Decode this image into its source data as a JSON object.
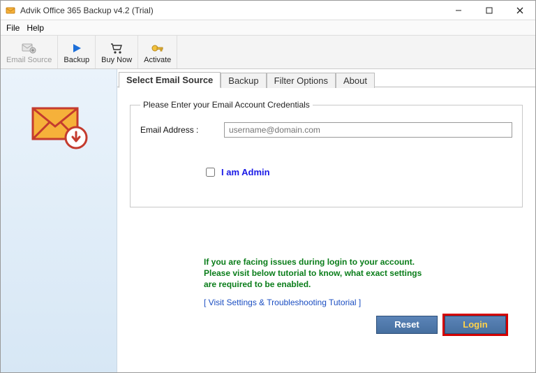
{
  "titlebar": {
    "title": "Advik Office 365 Backup v4.2 (Trial)"
  },
  "menu": {
    "file": "File",
    "help": "Help"
  },
  "toolbar": {
    "email_source": "Email Source",
    "backup": "Backup",
    "buy_now": "Buy Now",
    "activate": "Activate"
  },
  "tabs": {
    "select_email_source": "Select Email Source",
    "backup": "Backup",
    "filter_options": "Filter Options",
    "about": "About"
  },
  "form": {
    "legend": "Please Enter your Email Account Credentials",
    "email_label": "Email Address :",
    "email_placeholder": "username@domain.com",
    "admin_label": "I am Admin"
  },
  "help": {
    "line1": "If you are facing issues during login to your account.",
    "line2": "Please visit below tutorial to know, what exact settings",
    "line3": "are required to be enabled.",
    "tutorial": "[ Visit Settings & Troubleshooting Tutorial ]"
  },
  "buttons": {
    "reset": "Reset",
    "login": "Login"
  }
}
